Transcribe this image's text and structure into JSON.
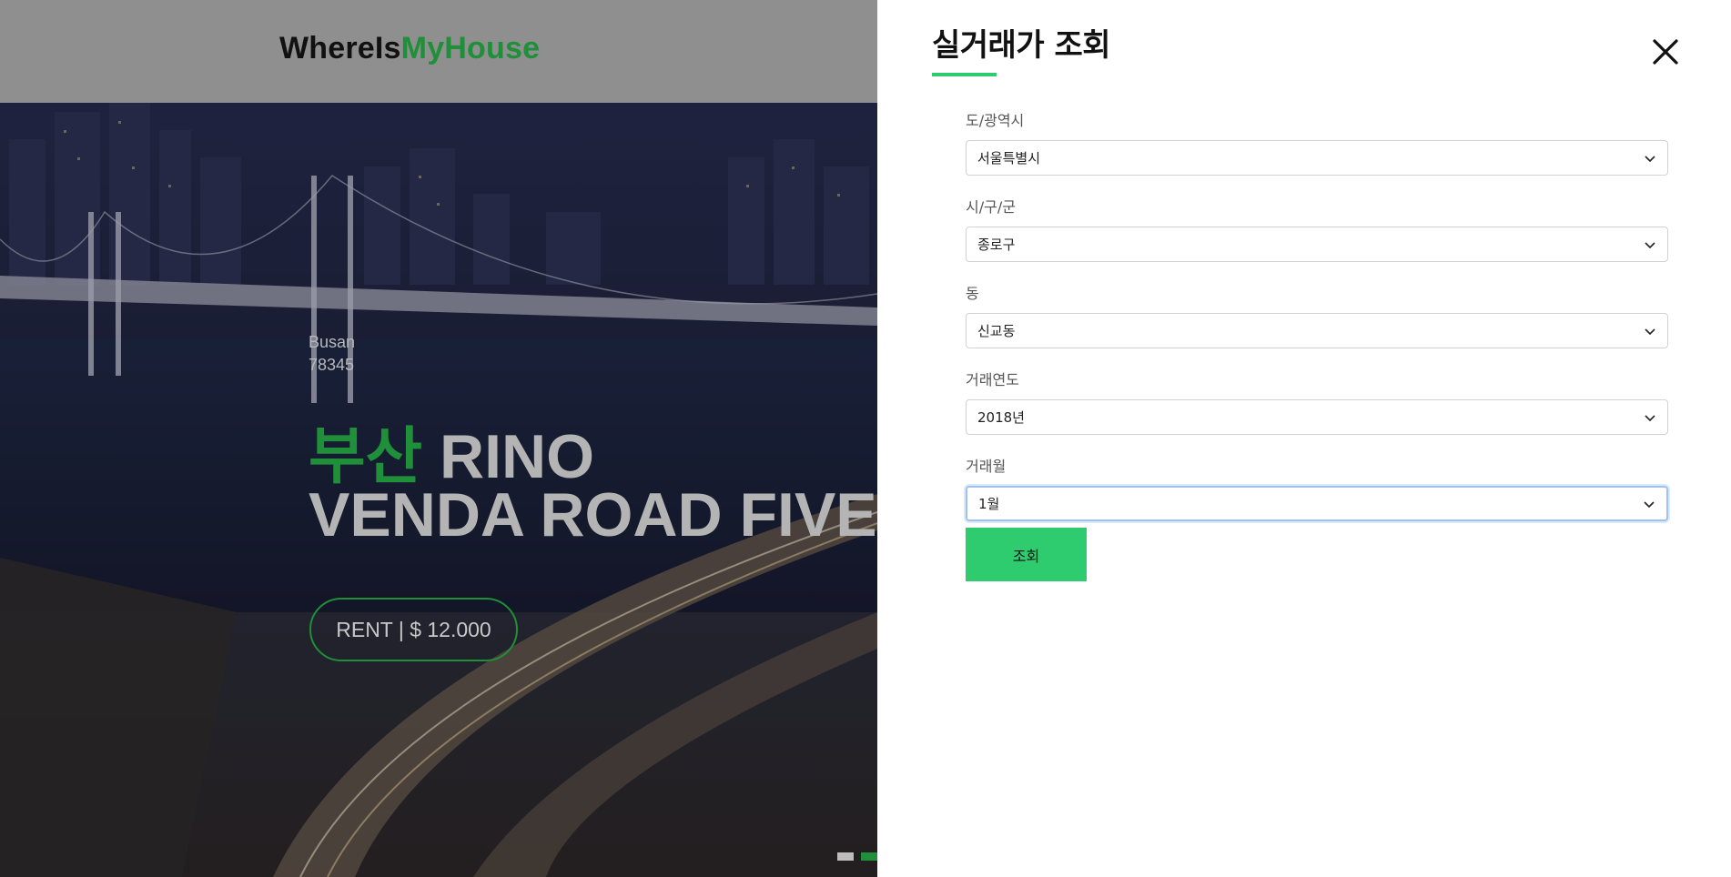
{
  "header": {
    "logo_part1": "WhereIs",
    "logo_part2": "MyHouse"
  },
  "hero": {
    "city": "Busan",
    "zip": "78345",
    "title_accent": "부산",
    "title_line1_rest": " RINO",
    "title_line2": "VENDA ROAD FIVE",
    "rent_label": "RENT | $ 12.000",
    "slider": {
      "count": 2,
      "active_index": 1
    }
  },
  "colors": {
    "brand_green": "#1f8f3a",
    "button_green": "#2ecc6e",
    "header_gray": "#8f8f8f"
  },
  "drawer": {
    "title": "실거래가 조회",
    "close_icon": "close-icon",
    "fields": [
      {
        "label": "도/광역시",
        "value": "서울특별시"
      },
      {
        "label": "시/구/군",
        "value": "종로구"
      },
      {
        "label": "동",
        "value": "신교동"
      },
      {
        "label": "거래연도",
        "value": "2018년"
      },
      {
        "label": "거래월",
        "value": "1월"
      }
    ],
    "search_label": "조회"
  }
}
